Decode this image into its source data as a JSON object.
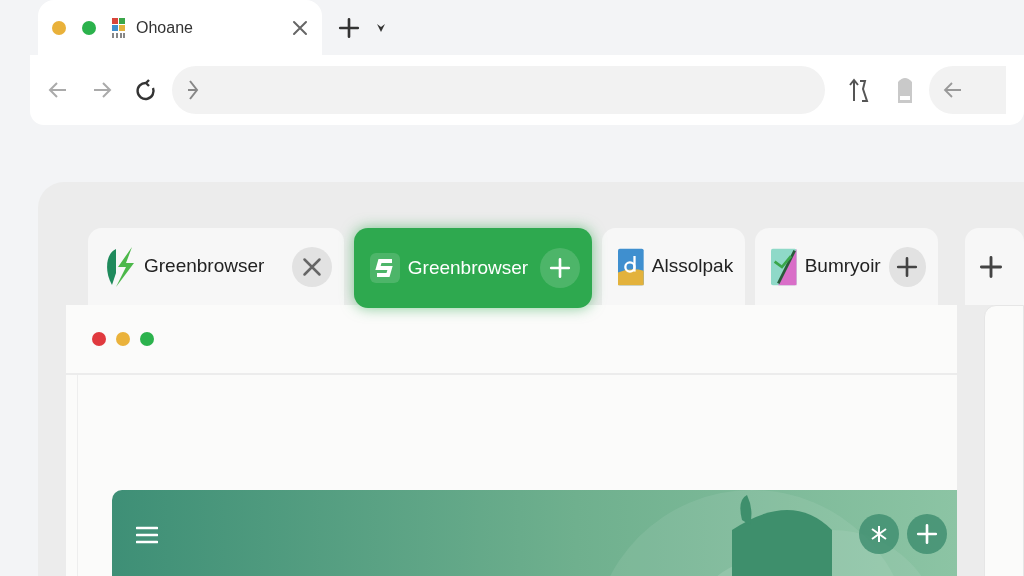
{
  "browser_tab": {
    "title": "Ohoane"
  },
  "window_dots": [
    {
      "color": "#e9b13a"
    },
    {
      "color": "#2bb24c"
    }
  ],
  "tabs": [
    {
      "title": "Greenbrowser",
      "selected": false,
      "kind": "closable"
    },
    {
      "title": "Greenbrowser",
      "selected": true,
      "kind": "addable"
    },
    {
      "title": "Alssolpak",
      "selected": false,
      "kind": "plain"
    },
    {
      "title": "Bumryoir",
      "selected": false,
      "kind": "addable"
    }
  ],
  "inner_dots": [
    {
      "color": "#e0393e"
    },
    {
      "color": "#eab23b"
    },
    {
      "color": "#2bb24c"
    }
  ]
}
